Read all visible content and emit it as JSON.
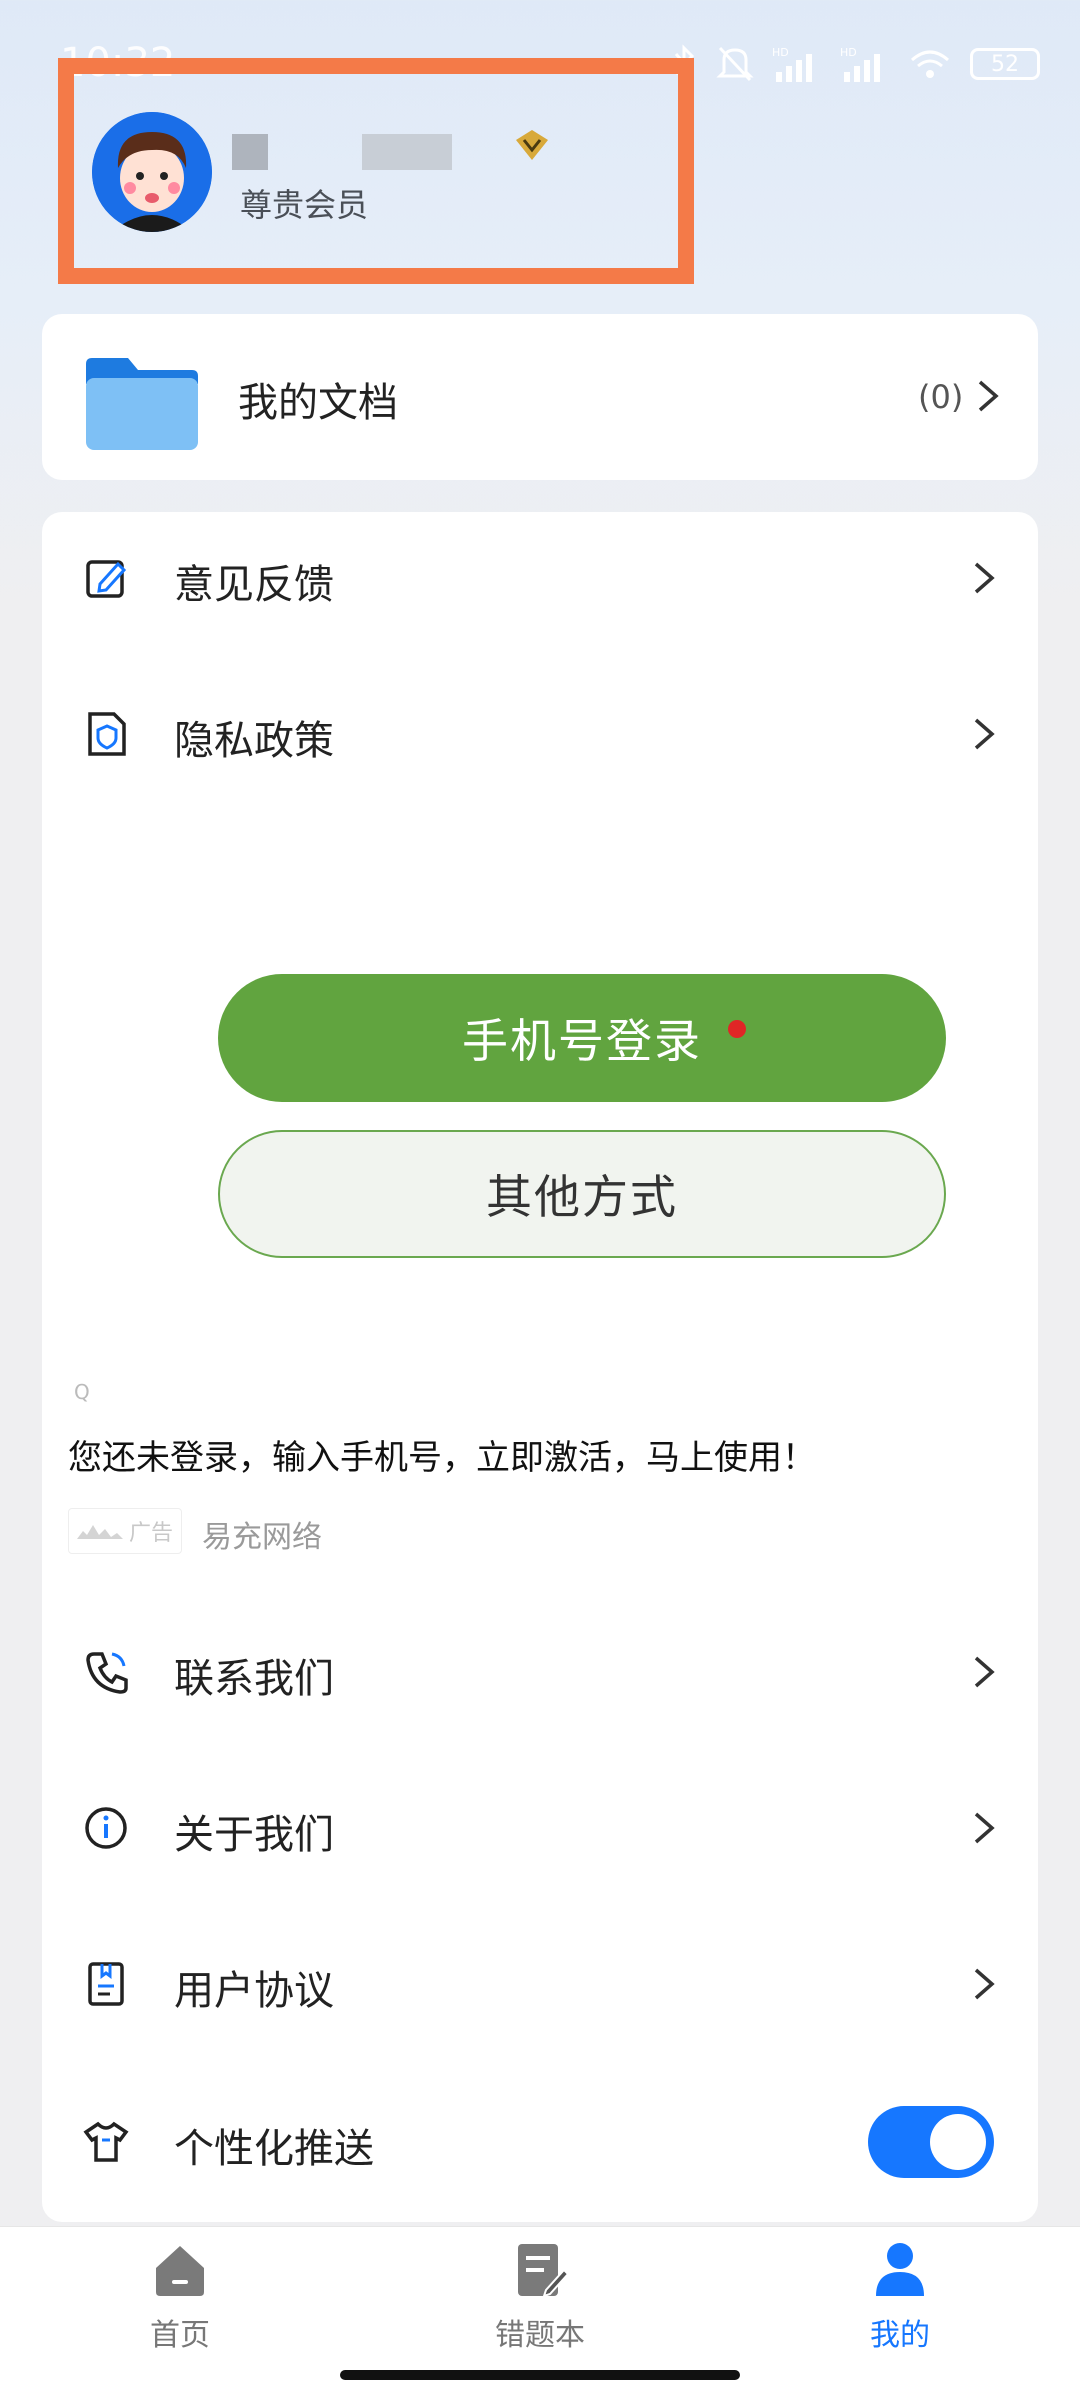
{
  "status_bar": {
    "time": "10:32",
    "battery": "52",
    "icons": [
      "bluetooth-icon",
      "mute-icon",
      "hd-signal-icon",
      "hd-signal-icon",
      "wifi-icon",
      "battery-icon"
    ]
  },
  "profile": {
    "member_label": "尊贵会员",
    "badge_icon": "vip-diamond-icon",
    "accent": "#f47a48"
  },
  "documents": {
    "title": "我的文档",
    "count": "(0)"
  },
  "menu": {
    "feedback": "意见反馈",
    "privacy": "隐私政策",
    "contact": "联系我们",
    "about": "关于我们",
    "agreement": "用户协议",
    "personalized_push": "个性化推送"
  },
  "login": {
    "phone_login": "手机号登录",
    "other_method": "其他方式",
    "primary_color": "#61a43f"
  },
  "ad": {
    "text": "您还未登录，输入手机号，立即激活，马上使用！",
    "tag": "广告",
    "source": "易充网络"
  },
  "toggle": {
    "personalized_push_on": true,
    "color": "#1677ff"
  },
  "bottom_nav": {
    "items": [
      {
        "label": "首页",
        "icon": "home-icon"
      },
      {
        "label": "错题本",
        "icon": "notebook-icon"
      },
      {
        "label": "我的",
        "icon": "person-icon"
      }
    ],
    "active_index": 2
  }
}
